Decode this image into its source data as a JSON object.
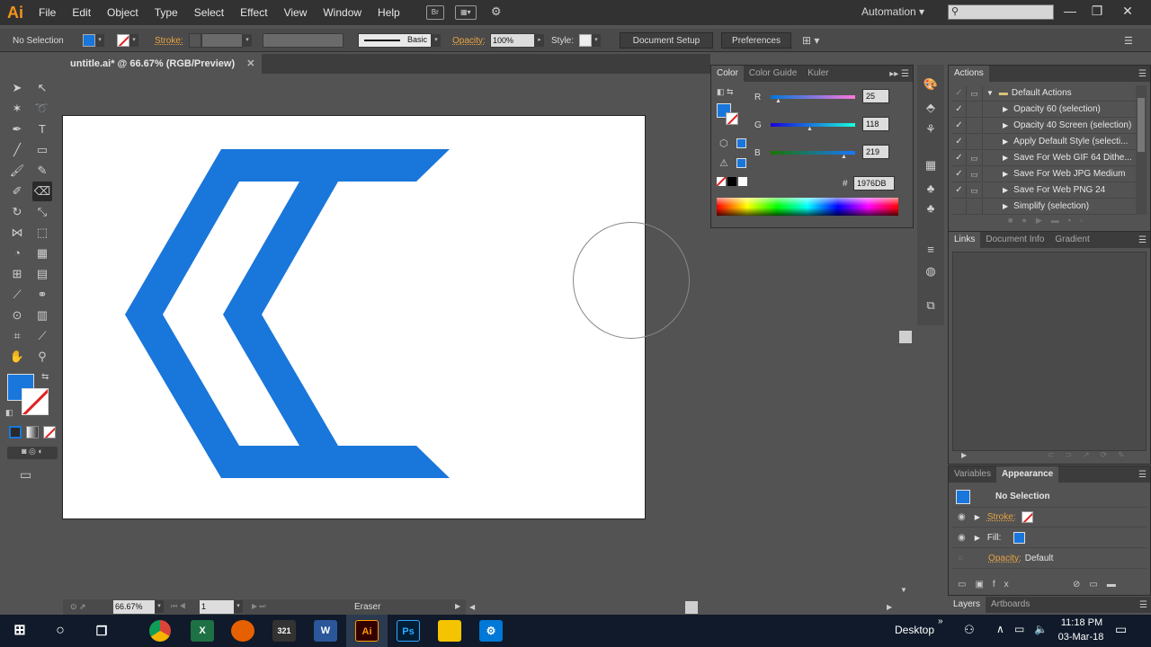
{
  "app": {
    "logo": "Ai"
  },
  "menu": [
    "File",
    "Edit",
    "Object",
    "Type",
    "Select",
    "Effect",
    "View",
    "Window",
    "Help"
  ],
  "menubar_icons": {
    "bridge": "Br"
  },
  "workspace": "Automation",
  "control_bar": {
    "selection_label": "No Selection",
    "stroke_label": "Stroke:",
    "brush_label": "Basic",
    "opacity_label": "Opacity:",
    "opacity_value": "100%",
    "style_label": "Style:",
    "document_setup": "Document Setup",
    "preferences": "Preferences"
  },
  "document_tab": "untitle.ai* @ 66.67% (RGB/Preview)",
  "colors": {
    "fill": "#1976DB",
    "ui_dark": "#323232",
    "panel": "#535353"
  },
  "color_panel": {
    "tabs": [
      "Color",
      "Color Guide",
      "Kuler"
    ],
    "r": {
      "label": "R",
      "value": "25"
    },
    "g": {
      "label": "G",
      "value": "118"
    },
    "b": {
      "label": "B",
      "value": "219"
    },
    "hex_symbol": "#",
    "hex": "1976DB"
  },
  "actions_panel": {
    "title": "Actions",
    "set": "Default Actions",
    "items": [
      "Opacity 60 (selection)",
      "Opacity 40 Screen (selection)",
      "Apply Default Style (selecti...",
      "Save For Web GIF 64 Dithe...",
      "Save For Web JPG Medium",
      "Save For Web PNG 24",
      "Simplify (selection)"
    ]
  },
  "links_panel": {
    "tabs": [
      "Links",
      "Document Info",
      "Gradient"
    ]
  },
  "appearance_panel": {
    "tabs": [
      "Variables",
      "Appearance"
    ],
    "title": "No Selection",
    "stroke_label": "Stroke:",
    "fill_label": "Fill:",
    "opacity_label": "Opacity:",
    "opacity_value": "Default"
  },
  "layers_panel": {
    "tabs": [
      "Layers",
      "Artboards"
    ]
  },
  "status_bar": {
    "zoom": "66.67%",
    "artboard": "1",
    "tool": "Eraser"
  },
  "taskbar": {
    "apps": [
      "Chrome",
      "Excel",
      "Firefox",
      "321",
      "Word",
      "Ai",
      "Ps",
      "Files",
      "Dev"
    ],
    "desktop": "Desktop",
    "time": "11:18 PM",
    "date": "03-Mar-18"
  }
}
